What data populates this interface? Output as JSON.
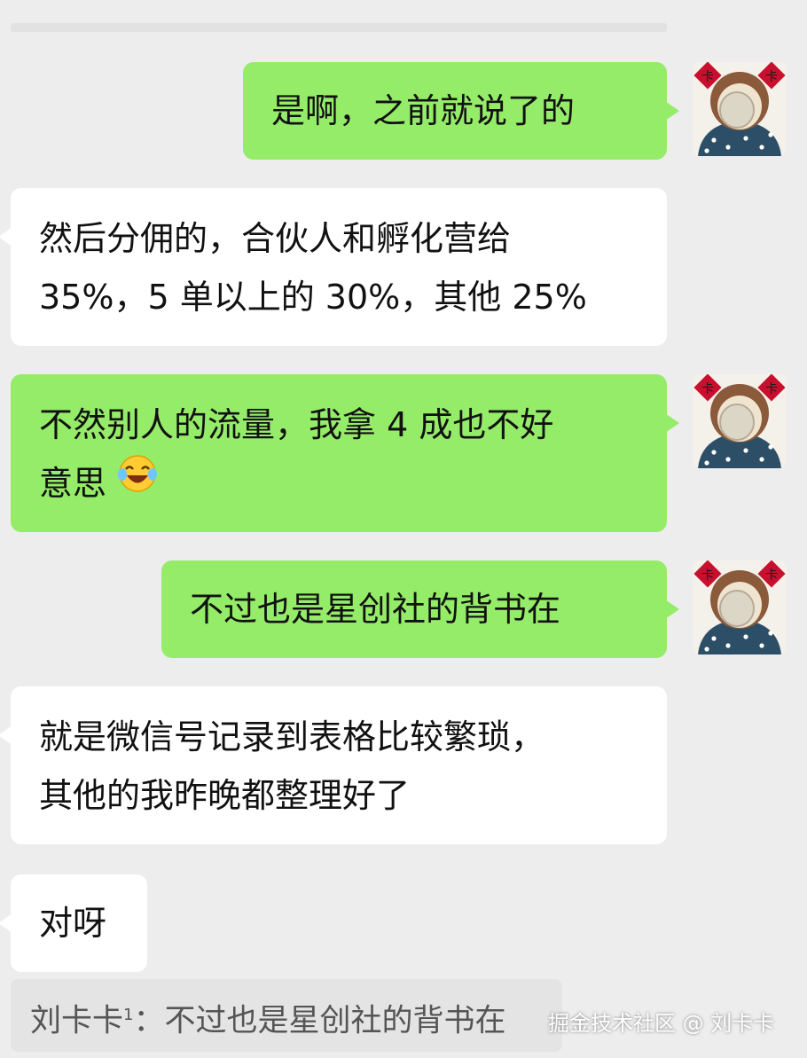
{
  "messages": [
    {
      "direction": "outgoing",
      "lines": [
        "是啊，之前就说了的"
      ]
    },
    {
      "direction": "incoming",
      "lines": [
        "然后分佣的，合伙人和孵化营给",
        "35%，5 单以上的 30%，其他 25%"
      ]
    },
    {
      "direction": "outgoing",
      "lines": [
        "不然别人的流量，我拿 4 成也不好",
        "意思"
      ],
      "emoji": "laughing-tears-emoji"
    },
    {
      "direction": "outgoing",
      "lines": [
        "不过也是星创社的背书在"
      ]
    },
    {
      "direction": "incoming",
      "lines": [
        "就是微信号记录到表格比较繁琐，",
        "其他的我昨晚都整理好了"
      ]
    },
    {
      "direction": "incoming",
      "lines": [
        "对呀"
      ]
    }
  ],
  "quote": {
    "sender": "刘卡卡",
    "sender_suffix": "1",
    "separator": "：",
    "text": "不过也是星创社的背书在"
  },
  "watermark": "掘金技术社区 @ 刘卡卡",
  "avatar_badge_text": "卡",
  "colors": {
    "background": "#ededed",
    "outgoing_bubble": "#95ec69",
    "incoming_bubble": "#ffffff",
    "badge_red": "#c8102e"
  }
}
